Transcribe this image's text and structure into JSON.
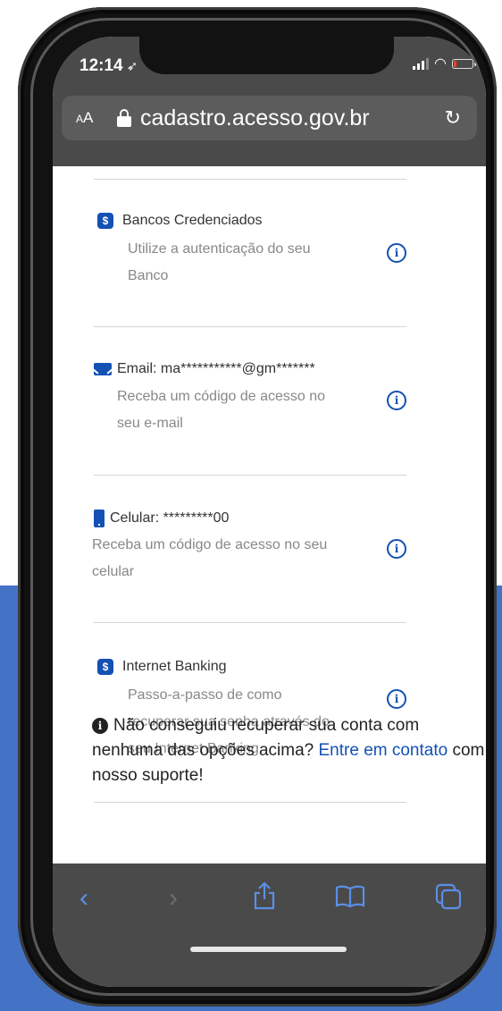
{
  "colors": {
    "brand_blue": "#1351b4",
    "background_blue": "#4472c4",
    "chrome_gray": "#4a4a4a"
  },
  "status_bar": {
    "time": "12:14",
    "location_icon": "location-arrow-icon",
    "battery_level": 0.15
  },
  "address_bar": {
    "text_size_label_small": "A",
    "text_size_label_large": "A",
    "url": "cadastro.acesso.gov.br"
  },
  "options": [
    {
      "icon": "bank-icon",
      "title": "Bancos Credenciados",
      "desc_lines": [
        "Utilize a autenticação do seu",
        "Banco"
      ]
    },
    {
      "icon": "mail-icon",
      "title": "Email: ma***********@gm*******",
      "desc_lines": [
        "Receba um código de acesso no",
        "seu e-mail"
      ]
    },
    {
      "icon": "phone-icon",
      "title": "Celular: *********00",
      "desc_lines": [
        "Receba um código de acesso no seu",
        "celular"
      ]
    },
    {
      "icon": "bank-icon",
      "title": "Internet Banking",
      "desc_lines": [
        "Passo-a-passo de como",
        "recuperar sua senha através do",
        "seu Internet Banking."
      ]
    }
  ],
  "help": {
    "text_before": "Não conseguiu recuperar sua conta com nenhuma das opções acima? ",
    "link_text": "Entre em contato",
    "text_after": " com nosso suporte!"
  },
  "toolbar": {
    "back_icon": "chevron-left-icon",
    "forward_icon": "chevron-right-icon",
    "share_icon": "share-icon",
    "bookmarks_icon": "book-icon",
    "tabs_icon": "tabs-icon"
  }
}
